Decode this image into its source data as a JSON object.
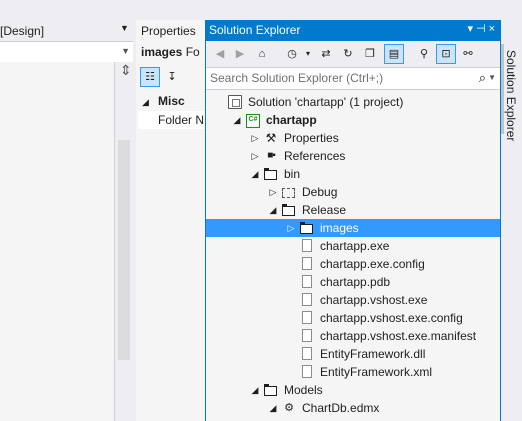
{
  "design": {
    "tab_title": "[Design]"
  },
  "properties": {
    "header": "Properties",
    "object_name": "images",
    "object_type": "Fo",
    "category": "Misc",
    "row_name": "Folder N"
  },
  "solution_explorer": {
    "title": "Solution Explorer",
    "search_placeholder": "Search Solution Explorer (Ctrl+;)",
    "side_tab": "Solution Explorer",
    "tree": [
      {
        "label": "Solution 'chartapp' (1 project)",
        "indent": 0,
        "icon": "solution",
        "arrow": "none"
      },
      {
        "label": "chartapp",
        "indent": 1,
        "icon": "csharp-project",
        "arrow": "expanded",
        "bold": true
      },
      {
        "label": "Properties",
        "indent": 2,
        "icon": "wrench",
        "arrow": "collapsed"
      },
      {
        "label": "References",
        "indent": 2,
        "icon": "references",
        "arrow": "collapsed"
      },
      {
        "label": "bin",
        "indent": 2,
        "icon": "folder-open",
        "arrow": "expanded"
      },
      {
        "label": "Debug",
        "indent": 3,
        "icon": "folder-dashed",
        "arrow": "collapsed"
      },
      {
        "label": "Release",
        "indent": 3,
        "icon": "folder-open",
        "arrow": "expanded"
      },
      {
        "label": "images",
        "indent": 4,
        "icon": "folder-selected",
        "arrow": "collapsed",
        "selected": true
      },
      {
        "label": "chartapp.exe",
        "indent": 4,
        "icon": "file",
        "arrow": "none"
      },
      {
        "label": "chartapp.exe.config",
        "indent": 4,
        "icon": "file",
        "arrow": "none"
      },
      {
        "label": "chartapp.pdb",
        "indent": 4,
        "icon": "file",
        "arrow": "none"
      },
      {
        "label": "chartapp.vshost.exe",
        "indent": 4,
        "icon": "file",
        "arrow": "none"
      },
      {
        "label": "chartapp.vshost.exe.config",
        "indent": 4,
        "icon": "file",
        "arrow": "none"
      },
      {
        "label": "chartapp.vshost.exe.manifest",
        "indent": 4,
        "icon": "file",
        "arrow": "none"
      },
      {
        "label": "EntityFramework.dll",
        "indent": 4,
        "icon": "file",
        "arrow": "none"
      },
      {
        "label": "EntityFramework.xml",
        "indent": 4,
        "icon": "file",
        "arrow": "none"
      },
      {
        "label": "Models",
        "indent": 2,
        "icon": "folder-open",
        "arrow": "expanded"
      },
      {
        "label": "ChartDb.edmx",
        "indent": 3,
        "icon": "edmx",
        "arrow": "expanded"
      }
    ]
  },
  "colors": {
    "accent": "#007acc",
    "selection": "#3399ff",
    "panel_bg": "#f5f5f5",
    "chrome_bg": "#eeeef2"
  }
}
